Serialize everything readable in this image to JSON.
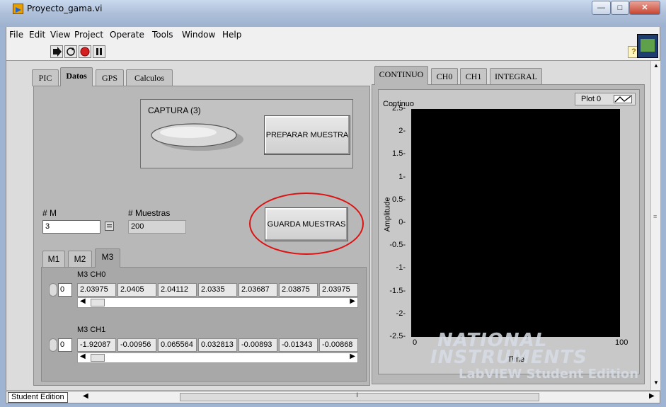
{
  "window": {
    "title": "Proyecto_gama.vi"
  },
  "menu": [
    "File",
    "Edit",
    "View",
    "Project",
    "Operate",
    "Tools",
    "Window",
    "Help"
  ],
  "left_tabs": [
    "PIC",
    "Datos",
    "GPS",
    "Calculos"
  ],
  "captura": {
    "label": "CAPTURA (3)"
  },
  "buttons": {
    "preparar": "PREPARAR MUESTRA",
    "guarda": "GUARDA MUESTRAS"
  },
  "m_control": {
    "label": "# M",
    "value": "3"
  },
  "muestras": {
    "label": "# Muestras",
    "value": "200"
  },
  "m_tabs": [
    "M1",
    "M2",
    "M3"
  ],
  "ch0": {
    "label": "M3 CH0",
    "index": "0",
    "values": [
      "2.03975",
      "2.0405",
      "2.04112",
      "2.0335",
      "2.03687",
      "2.03875",
      "2.03975"
    ]
  },
  "ch1": {
    "label": "M3 CH1",
    "index": "0",
    "values": [
      "-1.92087",
      "-0.00956",
      "0.065564",
      "0.032813",
      "-0.00893",
      "-0.01343",
      "-0.00868"
    ]
  },
  "right_tabs": [
    "CONTINUO",
    "CH0",
    "CH1",
    "INTEGRAL"
  ],
  "chart_data": {
    "type": "line",
    "title": "Continuo",
    "xlabel": "Time",
    "ylabel": "Amplitude",
    "xlim": [
      0,
      100
    ],
    "ylim": [
      -2.5,
      2.5
    ],
    "y_ticks": [
      "2.5",
      "2",
      "1.5",
      "1",
      "0.5",
      "0",
      "-0.5",
      "-1",
      "-1.5",
      "-2",
      "-2.5"
    ],
    "x_ticks": [
      "0",
      "100"
    ],
    "series": [
      {
        "name": "Plot 0",
        "values": []
      }
    ],
    "grid": false,
    "legend_position": "top-right",
    "plot_background": "#000000"
  },
  "status": {
    "edition": "Student Edition"
  },
  "watermark": {
    "line1": "NATIONAL",
    "line2": "INSTRUMENTS",
    "line3": "LabVIEW Student Edition"
  },
  "colors": {
    "highlight_circle": "#dd1111",
    "panel": "#dcdcdc",
    "tab_body": "#b8b8b8"
  }
}
